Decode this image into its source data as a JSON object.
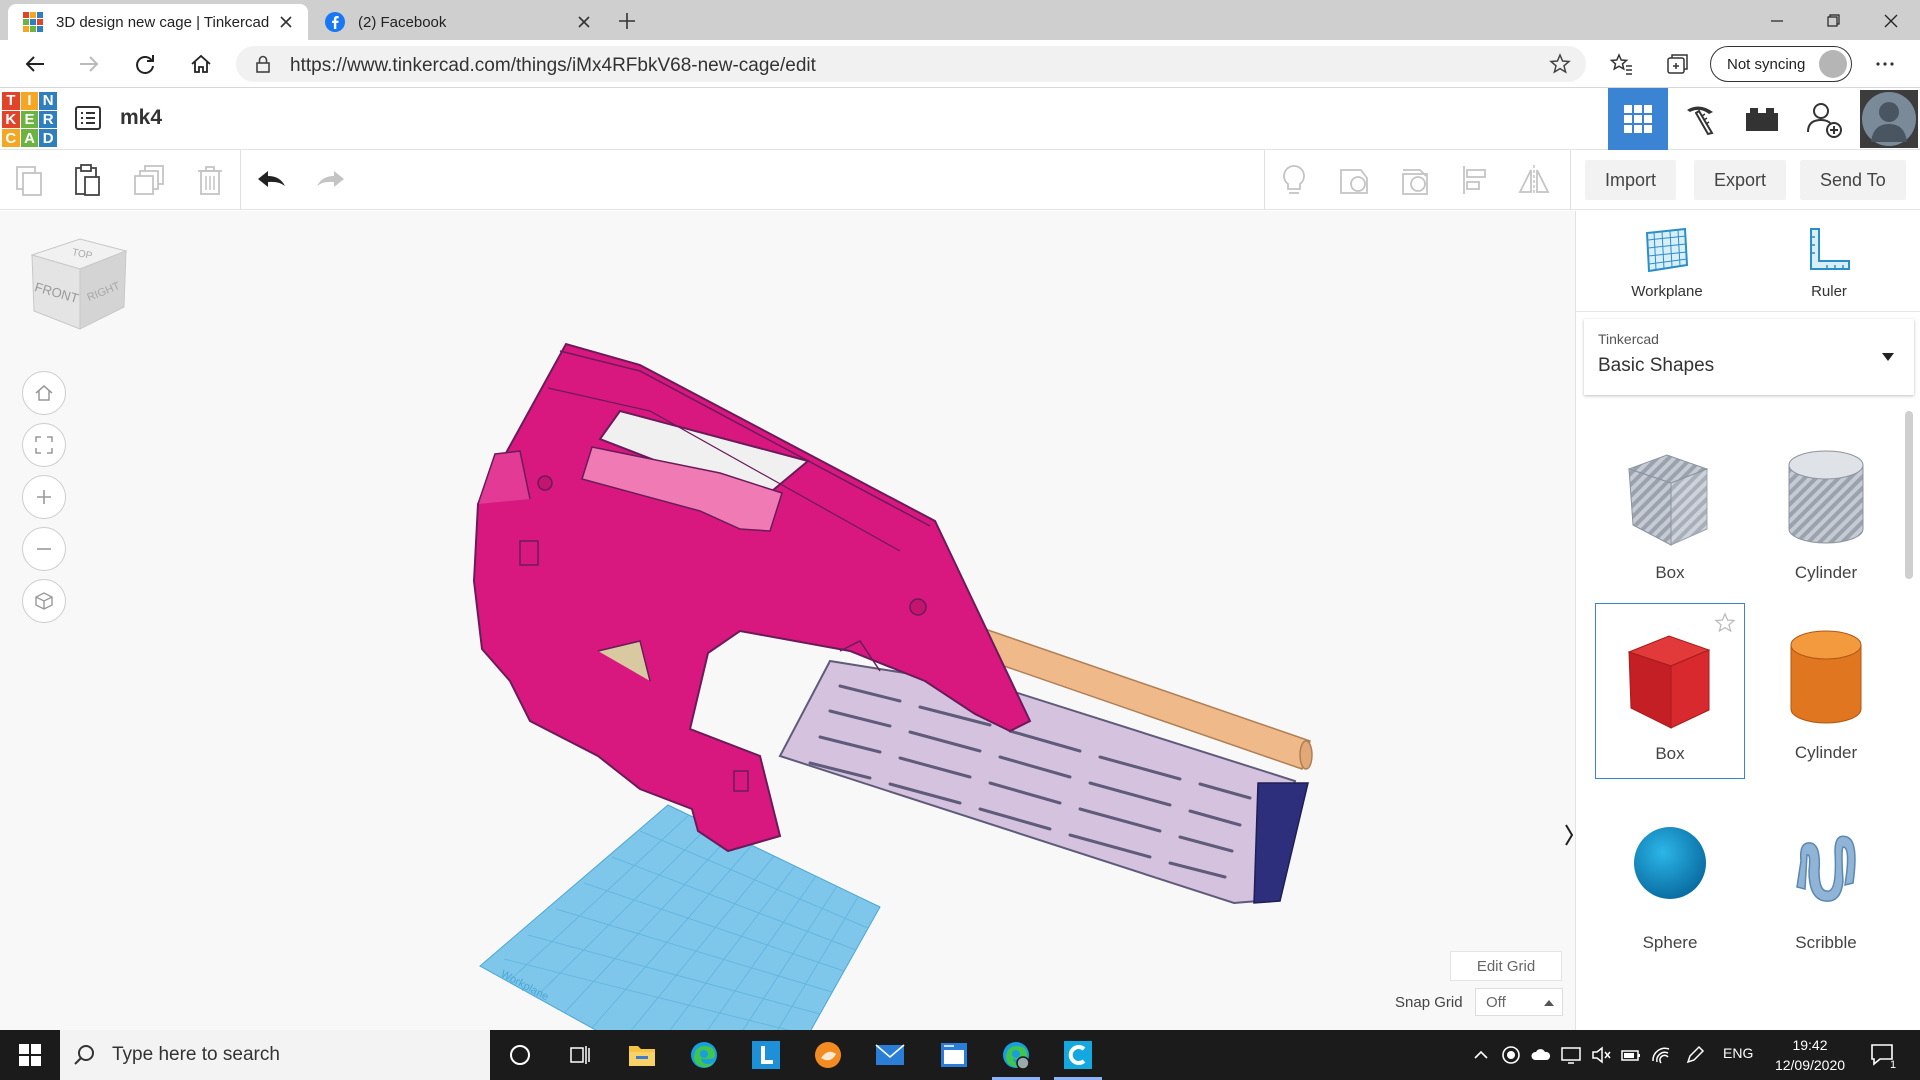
{
  "browser": {
    "tabs": [
      {
        "title": "3D design new cage | Tinkercad",
        "active": true
      },
      {
        "title": "(2) Facebook",
        "active": false
      }
    ],
    "url": "https://www.tinkercad.com/things/iMx4RFbkV68-new-cage/edit",
    "sync_label": "Not syncing"
  },
  "app": {
    "logo_letters": [
      "T",
      "I",
      "N",
      "K",
      "E",
      "R",
      "C",
      "A",
      "D"
    ],
    "logo_colors": [
      "#e2432b",
      "#f5a623",
      "#2f7fbf",
      "#e2432b",
      "#6cb33f",
      "#2f7fbf",
      "#f5a623",
      "#6cb33f",
      "#2f7fbf"
    ],
    "design_name": "mk4",
    "accent": "#3b84d4"
  },
  "toolbar": {
    "import_label": "Import",
    "export_label": "Export",
    "send_to_label": "Send To"
  },
  "viewcube": {
    "top": "TOP",
    "front": "FRONT",
    "right": "RIGHT"
  },
  "viewport": {
    "edit_grid_label": "Edit Grid",
    "snap_grid_label": "Snap Grid",
    "snap_grid_value": "Off",
    "workplane_text": "Workplane"
  },
  "panel": {
    "tools": [
      {
        "label": "Workplane",
        "icon": "workplane-icon"
      },
      {
        "label": "Ruler",
        "icon": "ruler-icon"
      }
    ],
    "library_provider": "Tinkercad",
    "library_name": "Basic Shapes",
    "shapes": [
      {
        "label": "Box",
        "icon": "box-hole-icon"
      },
      {
        "label": "Cylinder",
        "icon": "cylinder-hole-icon"
      },
      {
        "label": "Box",
        "icon": "box-icon",
        "selected": true
      },
      {
        "label": "Cylinder",
        "icon": "cylinder-icon"
      },
      {
        "label": "Sphere",
        "icon": "sphere-icon"
      },
      {
        "label": "Scribble",
        "icon": "scribble-icon"
      }
    ]
  },
  "taskbar": {
    "search_placeholder": "Type here to search",
    "lang": "ENG",
    "time": "19:42",
    "date": "12/09/2020",
    "notification_count": "1"
  }
}
